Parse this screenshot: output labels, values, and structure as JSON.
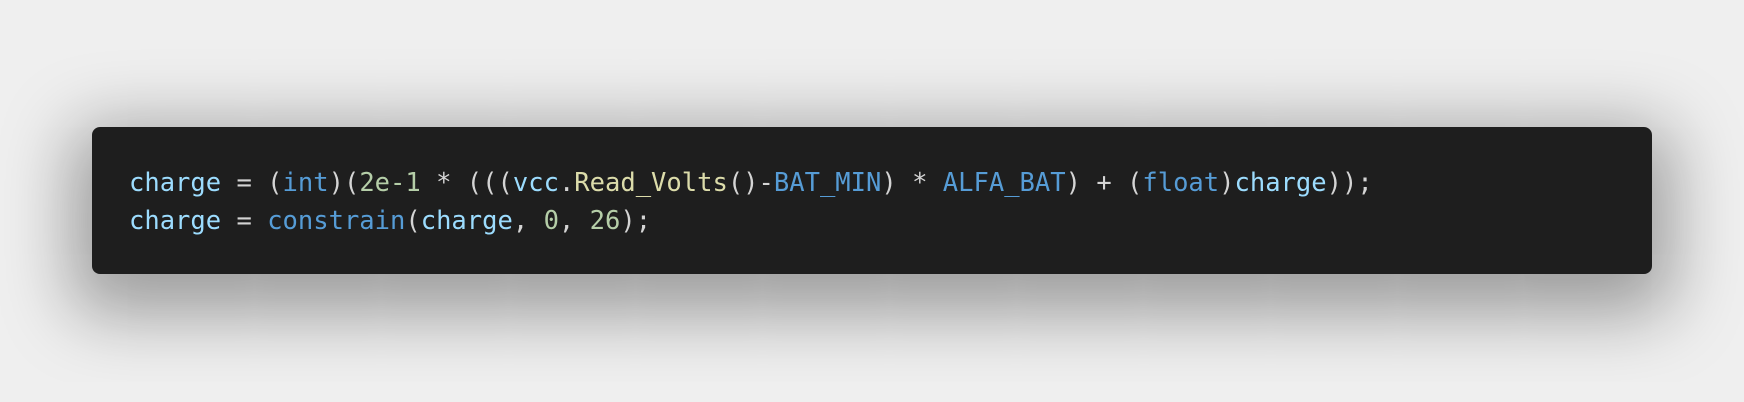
{
  "code": {
    "language": "c",
    "lines": [
      [
        {
          "t": "charge",
          "c": "v"
        },
        {
          "t": " = (",
          "c": "p"
        },
        {
          "t": "int",
          "c": "k"
        },
        {
          "t": ")(",
          "c": "p"
        },
        {
          "t": "2e-1",
          "c": "n"
        },
        {
          "t": " * (((",
          "c": "p"
        },
        {
          "t": "vcc",
          "c": "v"
        },
        {
          "t": ".",
          "c": "p"
        },
        {
          "t": "Read_Volts",
          "c": "f"
        },
        {
          "t": "()-",
          "c": "p"
        },
        {
          "t": "BAT_MIN",
          "c": "k"
        },
        {
          "t": ") * ",
          "c": "p"
        },
        {
          "t": "ALFA_BAT",
          "c": "k"
        },
        {
          "t": ") + (",
          "c": "p"
        },
        {
          "t": "float",
          "c": "k"
        },
        {
          "t": ")",
          "c": "p"
        },
        {
          "t": "charge",
          "c": "v"
        },
        {
          "t": "));",
          "c": "p"
        }
      ],
      [
        {
          "t": "charge",
          "c": "v"
        },
        {
          "t": " = ",
          "c": "p"
        },
        {
          "t": "constrain",
          "c": "k"
        },
        {
          "t": "(",
          "c": "p"
        },
        {
          "t": "charge",
          "c": "v"
        },
        {
          "t": ", ",
          "c": "p"
        },
        {
          "t": "0",
          "c": "n"
        },
        {
          "t": ", ",
          "c": "p"
        },
        {
          "t": "26",
          "c": "n"
        },
        {
          "t": ");",
          "c": "p"
        }
      ]
    ]
  },
  "colors": {
    "background": "#1e1e1e",
    "variable": "#9cdcfe",
    "keyword": "#569cd6",
    "number": "#b5cea8",
    "function": "#dcdcaa",
    "punctuation": "#d4d4d4"
  }
}
